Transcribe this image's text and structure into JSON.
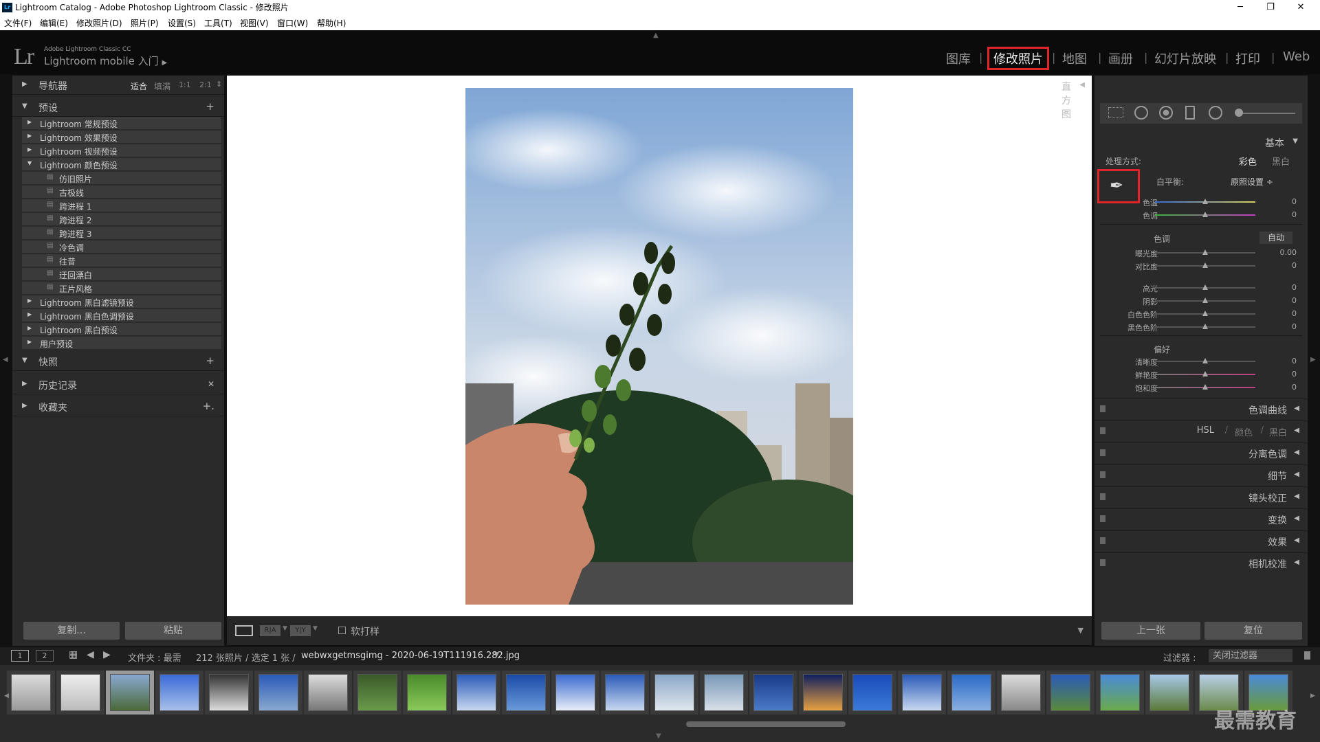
{
  "window": {
    "title": "Lightroom Catalog - Adobe Photoshop Lightroom Classic - 修改照片",
    "app_icon": "Lr",
    "minimize": "─",
    "maximize": "❐",
    "close": "✕"
  },
  "menu": [
    "文件(F)",
    "编辑(E)",
    "修改照片(D)",
    "照片(P)",
    "设置(S)",
    "工具(T)",
    "视图(V)",
    "窗口(W)",
    "帮助(H)"
  ],
  "header": {
    "logo": "Lr",
    "brand_sub": "Adobe Lightroom Classic CC",
    "brand_main": "Lightroom mobile 入门",
    "brand_arrow": "▶",
    "modules": [
      "图库",
      "修改照片",
      "地图",
      "画册",
      "幻灯片放映",
      "打印",
      "Web"
    ],
    "active_module": "修改照片",
    "separator": "|"
  },
  "left": {
    "navigator": {
      "label": "导航器",
      "zoom": [
        "适合",
        "填满",
        "1:1",
        "2:1"
      ],
      "zoom_arrow": "⇕"
    },
    "presets": {
      "label": "预设",
      "add": "+",
      "groups": [
        {
          "label": "Lightroom 常规预设",
          "open": false
        },
        {
          "label": "Lightroom 效果预设",
          "open": false
        },
        {
          "label": "Lightroom 视频预设",
          "open": false
        },
        {
          "label": "Lightroom 颜色预设",
          "open": true
        }
      ],
      "items": [
        "仿旧照片",
        "古极线",
        "跨进程 1",
        "跨进程 2",
        "跨进程 3",
        "冷色调",
        "往昔",
        "迂回漂白",
        "正片风格"
      ],
      "groups_after": [
        "Lightroom 黑白滤镜预设",
        "Lightroom 黑白色调预设",
        "Lightroom 黑白预设",
        "用户预设"
      ]
    },
    "snapshots": {
      "label": "快照",
      "action": "+"
    },
    "history": {
      "label": "历史记录",
      "action": "✕"
    },
    "collections": {
      "label": "收藏夹",
      "action": "+."
    },
    "copy_button": "复制...",
    "paste_button": "粘贴"
  },
  "toolbar": {
    "view_icons": [
      "loupe",
      "before-after",
      "yy"
    ],
    "soft_proof": "软打样",
    "expand_arrow": "▼"
  },
  "right": {
    "histogram": "直方图",
    "basic": "基本",
    "treatment_label": "处理方式:",
    "treatment_color": "彩色",
    "treatment_bw": "黑白",
    "wb_label": "白平衡:",
    "wb_value": "原照设置 ÷",
    "wb_sliders": [
      {
        "label": "色温",
        "value": "0",
        "pos": 0.5
      },
      {
        "label": "色调",
        "value": "0",
        "pos": 0.5
      }
    ],
    "tone_label": "色调",
    "auto": "自动",
    "tone_sliders": [
      {
        "label": "曝光度",
        "value": "0.00",
        "pos": 0.5
      },
      {
        "label": "对比度",
        "value": "0",
        "pos": 0.5
      },
      {
        "label": "高光",
        "value": "0",
        "pos": 0.5
      },
      {
        "label": "阴影",
        "value": "0",
        "pos": 0.5
      },
      {
        "label": "白色色阶",
        "value": "0",
        "pos": 0.5
      },
      {
        "label": "黑色色阶",
        "value": "0",
        "pos": 0.5
      }
    ],
    "presence_label": "偏好",
    "presence_sliders": [
      {
        "label": "清晰度",
        "value": "0",
        "pos": 0.5
      },
      {
        "label": "鲜艳度",
        "value": "0",
        "pos": 0.5
      },
      {
        "label": "饱和度",
        "value": "0",
        "pos": 0.5
      }
    ],
    "panels": [
      "色调曲线",
      "分离色调",
      "细节",
      "镜头校正",
      "变换",
      "效果",
      "相机校准"
    ],
    "hsl": {
      "label": "HSL",
      "color": "颜色",
      "bw": "黑白",
      "sep": "/"
    },
    "prev_button": "上一张",
    "reset_button": "复位"
  },
  "filmbar": {
    "page1": "1",
    "page2": "2",
    "folder": "文件夹 : 最需",
    "count": "212 张照片 / 选定 1 张 /",
    "filename": "webwxgetmsgimg - 2020-06-19T111916.282.jpg",
    "filter_label": "过滤器 :",
    "filter_value": "关闭过滤器"
  },
  "watermark": "最需教育",
  "colors": {
    "accent": "#e0242a",
    "panel": "#2a2a2a",
    "background": "#111111"
  }
}
